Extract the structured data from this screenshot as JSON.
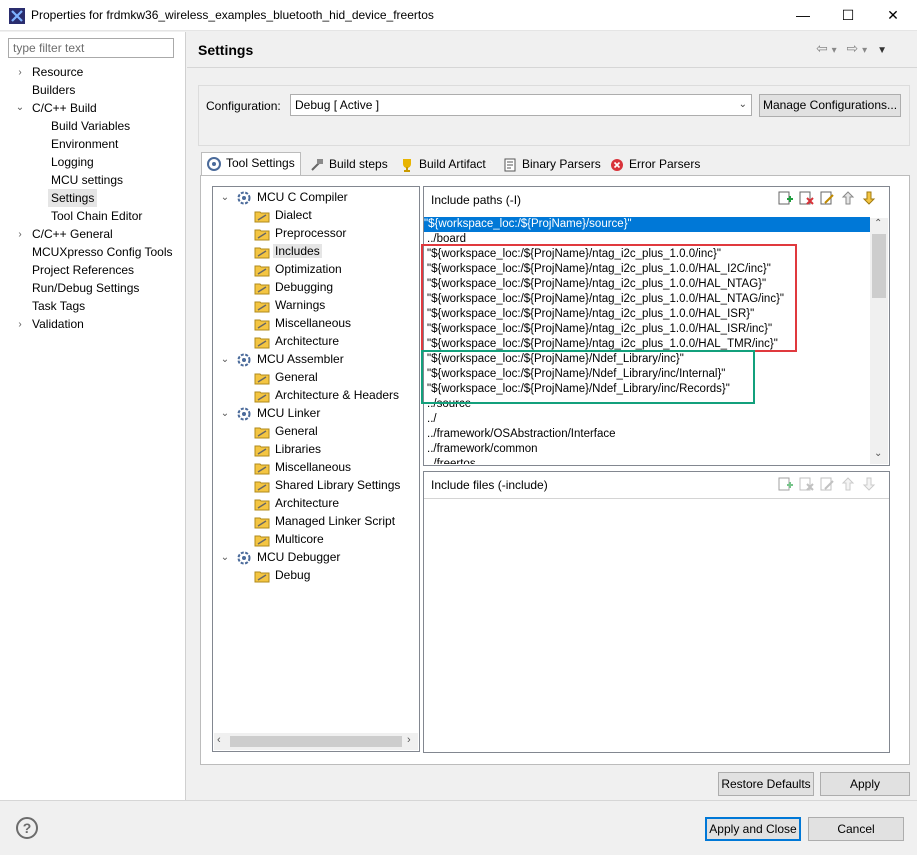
{
  "window": {
    "title": "Properties for frdmkw36_wireless_examples_bluetooth_hid_device_freertos",
    "minimize_glyph": "—",
    "maximize_glyph": "☐",
    "close_glyph": "✕"
  },
  "filter": {
    "placeholder": "type filter text"
  },
  "nav": [
    {
      "label": "Resource",
      "chevron": "›"
    },
    {
      "label": "Builders",
      "chevron": ""
    },
    {
      "label": "C/C++ Build",
      "chevron": "⌄"
    },
    {
      "label": "Build Variables",
      "chevron": ""
    },
    {
      "label": "Environment",
      "chevron": ""
    },
    {
      "label": "Logging",
      "chevron": ""
    },
    {
      "label": "MCU settings",
      "chevron": ""
    },
    {
      "label": "Settings",
      "chevron": ""
    },
    {
      "label": "Tool Chain Editor",
      "chevron": ""
    },
    {
      "label": "C/C++ General",
      "chevron": "›"
    },
    {
      "label": "MCUXpresso Config Tools",
      "chevron": ""
    },
    {
      "label": "Project References",
      "chevron": ""
    },
    {
      "label": "Run/Debug Settings",
      "chevron": ""
    },
    {
      "label": "Task Tags",
      "chevron": ""
    },
    {
      "label": "Validation",
      "chevron": "›"
    }
  ],
  "header": {
    "title": "Settings",
    "back_glyph": "⇦",
    "forward_glyph": "⇨",
    "dropdown_glyph": "▾",
    "menu_glyph": "▼"
  },
  "config": {
    "label": "Configuration:",
    "value": "Debug  [ Active ]",
    "manage_label": "Manage Configurations..."
  },
  "tabs": [
    {
      "label": "Tool Settings",
      "icon": "tool-settings-icon"
    },
    {
      "label": "Build steps",
      "icon": "build-steps-icon"
    },
    {
      "label": "Build Artifact",
      "icon": "trophy-icon"
    },
    {
      "label": "Binary Parsers",
      "icon": "binary-parsers-icon"
    },
    {
      "label": "Error Parsers",
      "icon": "error-parsers-icon"
    }
  ],
  "tool_tree": [
    {
      "label": "MCU C Compiler",
      "level": 0
    },
    {
      "label": "Dialect",
      "level": 1
    },
    {
      "label": "Preprocessor",
      "level": 1
    },
    {
      "label": "Includes",
      "level": 1
    },
    {
      "label": "Optimization",
      "level": 1
    },
    {
      "label": "Debugging",
      "level": 1
    },
    {
      "label": "Warnings",
      "level": 1
    },
    {
      "label": "Miscellaneous",
      "level": 1
    },
    {
      "label": "Architecture",
      "level": 1
    },
    {
      "label": "MCU Assembler",
      "level": 0
    },
    {
      "label": "General",
      "level": 1
    },
    {
      "label": "Architecture & Headers",
      "level": 1
    },
    {
      "label": "MCU Linker",
      "level": 0
    },
    {
      "label": "General",
      "level": 1
    },
    {
      "label": "Libraries",
      "level": 1
    },
    {
      "label": "Miscellaneous",
      "level": 1
    },
    {
      "label": "Shared Library Settings",
      "level": 1
    },
    {
      "label": "Architecture",
      "level": 1
    },
    {
      "label": "Managed Linker Script",
      "level": 1
    },
    {
      "label": "Multicore",
      "level": 1
    },
    {
      "label": "MCU Debugger",
      "level": 0
    },
    {
      "label": "Debug",
      "level": 1
    }
  ],
  "include_paths": {
    "title": "Include paths (-I)",
    "items": [
      "\"${workspace_loc:/${ProjName}/source}\"",
      "../board",
      "\"${workspace_loc:/${ProjName}/ntag_i2c_plus_1.0.0/inc}\"",
      "\"${workspace_loc:/${ProjName}/ntag_i2c_plus_1.0.0/HAL_I2C/inc}\"",
      "\"${workspace_loc:/${ProjName}/ntag_i2c_plus_1.0.0/HAL_NTAG}\"",
      "\"${workspace_loc:/${ProjName}/ntag_i2c_plus_1.0.0/HAL_NTAG/inc}\"",
      "\"${workspace_loc:/${ProjName}/ntag_i2c_plus_1.0.0/HAL_ISR}\"",
      "\"${workspace_loc:/${ProjName}/ntag_i2c_plus_1.0.0/HAL_ISR/inc}\"",
      "\"${workspace_loc:/${ProjName}/ntag_i2c_plus_1.0.0/HAL_TMR/inc}\"",
      "\"${workspace_loc:/${ProjName}/Ndef_Library/inc}\"",
      "\"${workspace_loc:/${ProjName}/Ndef_Library/inc/Internal}\"",
      "\"${workspace_loc:/${ProjName}/Ndef_Library/inc/Records}\"",
      "../source",
      "../",
      "../framework/OSAbstraction/Interface",
      "../framework/common",
      "../freertos"
    ]
  },
  "include_files": {
    "title": "Include files (-include)"
  },
  "highlight_colors": {
    "red": "#e0393e",
    "teal": "#13a07c"
  },
  "buttons": {
    "restore_defaults": "Restore Defaults",
    "apply": "Apply",
    "apply_and_close": "Apply and Close",
    "cancel": "Cancel"
  },
  "help": {
    "glyph": "?"
  }
}
